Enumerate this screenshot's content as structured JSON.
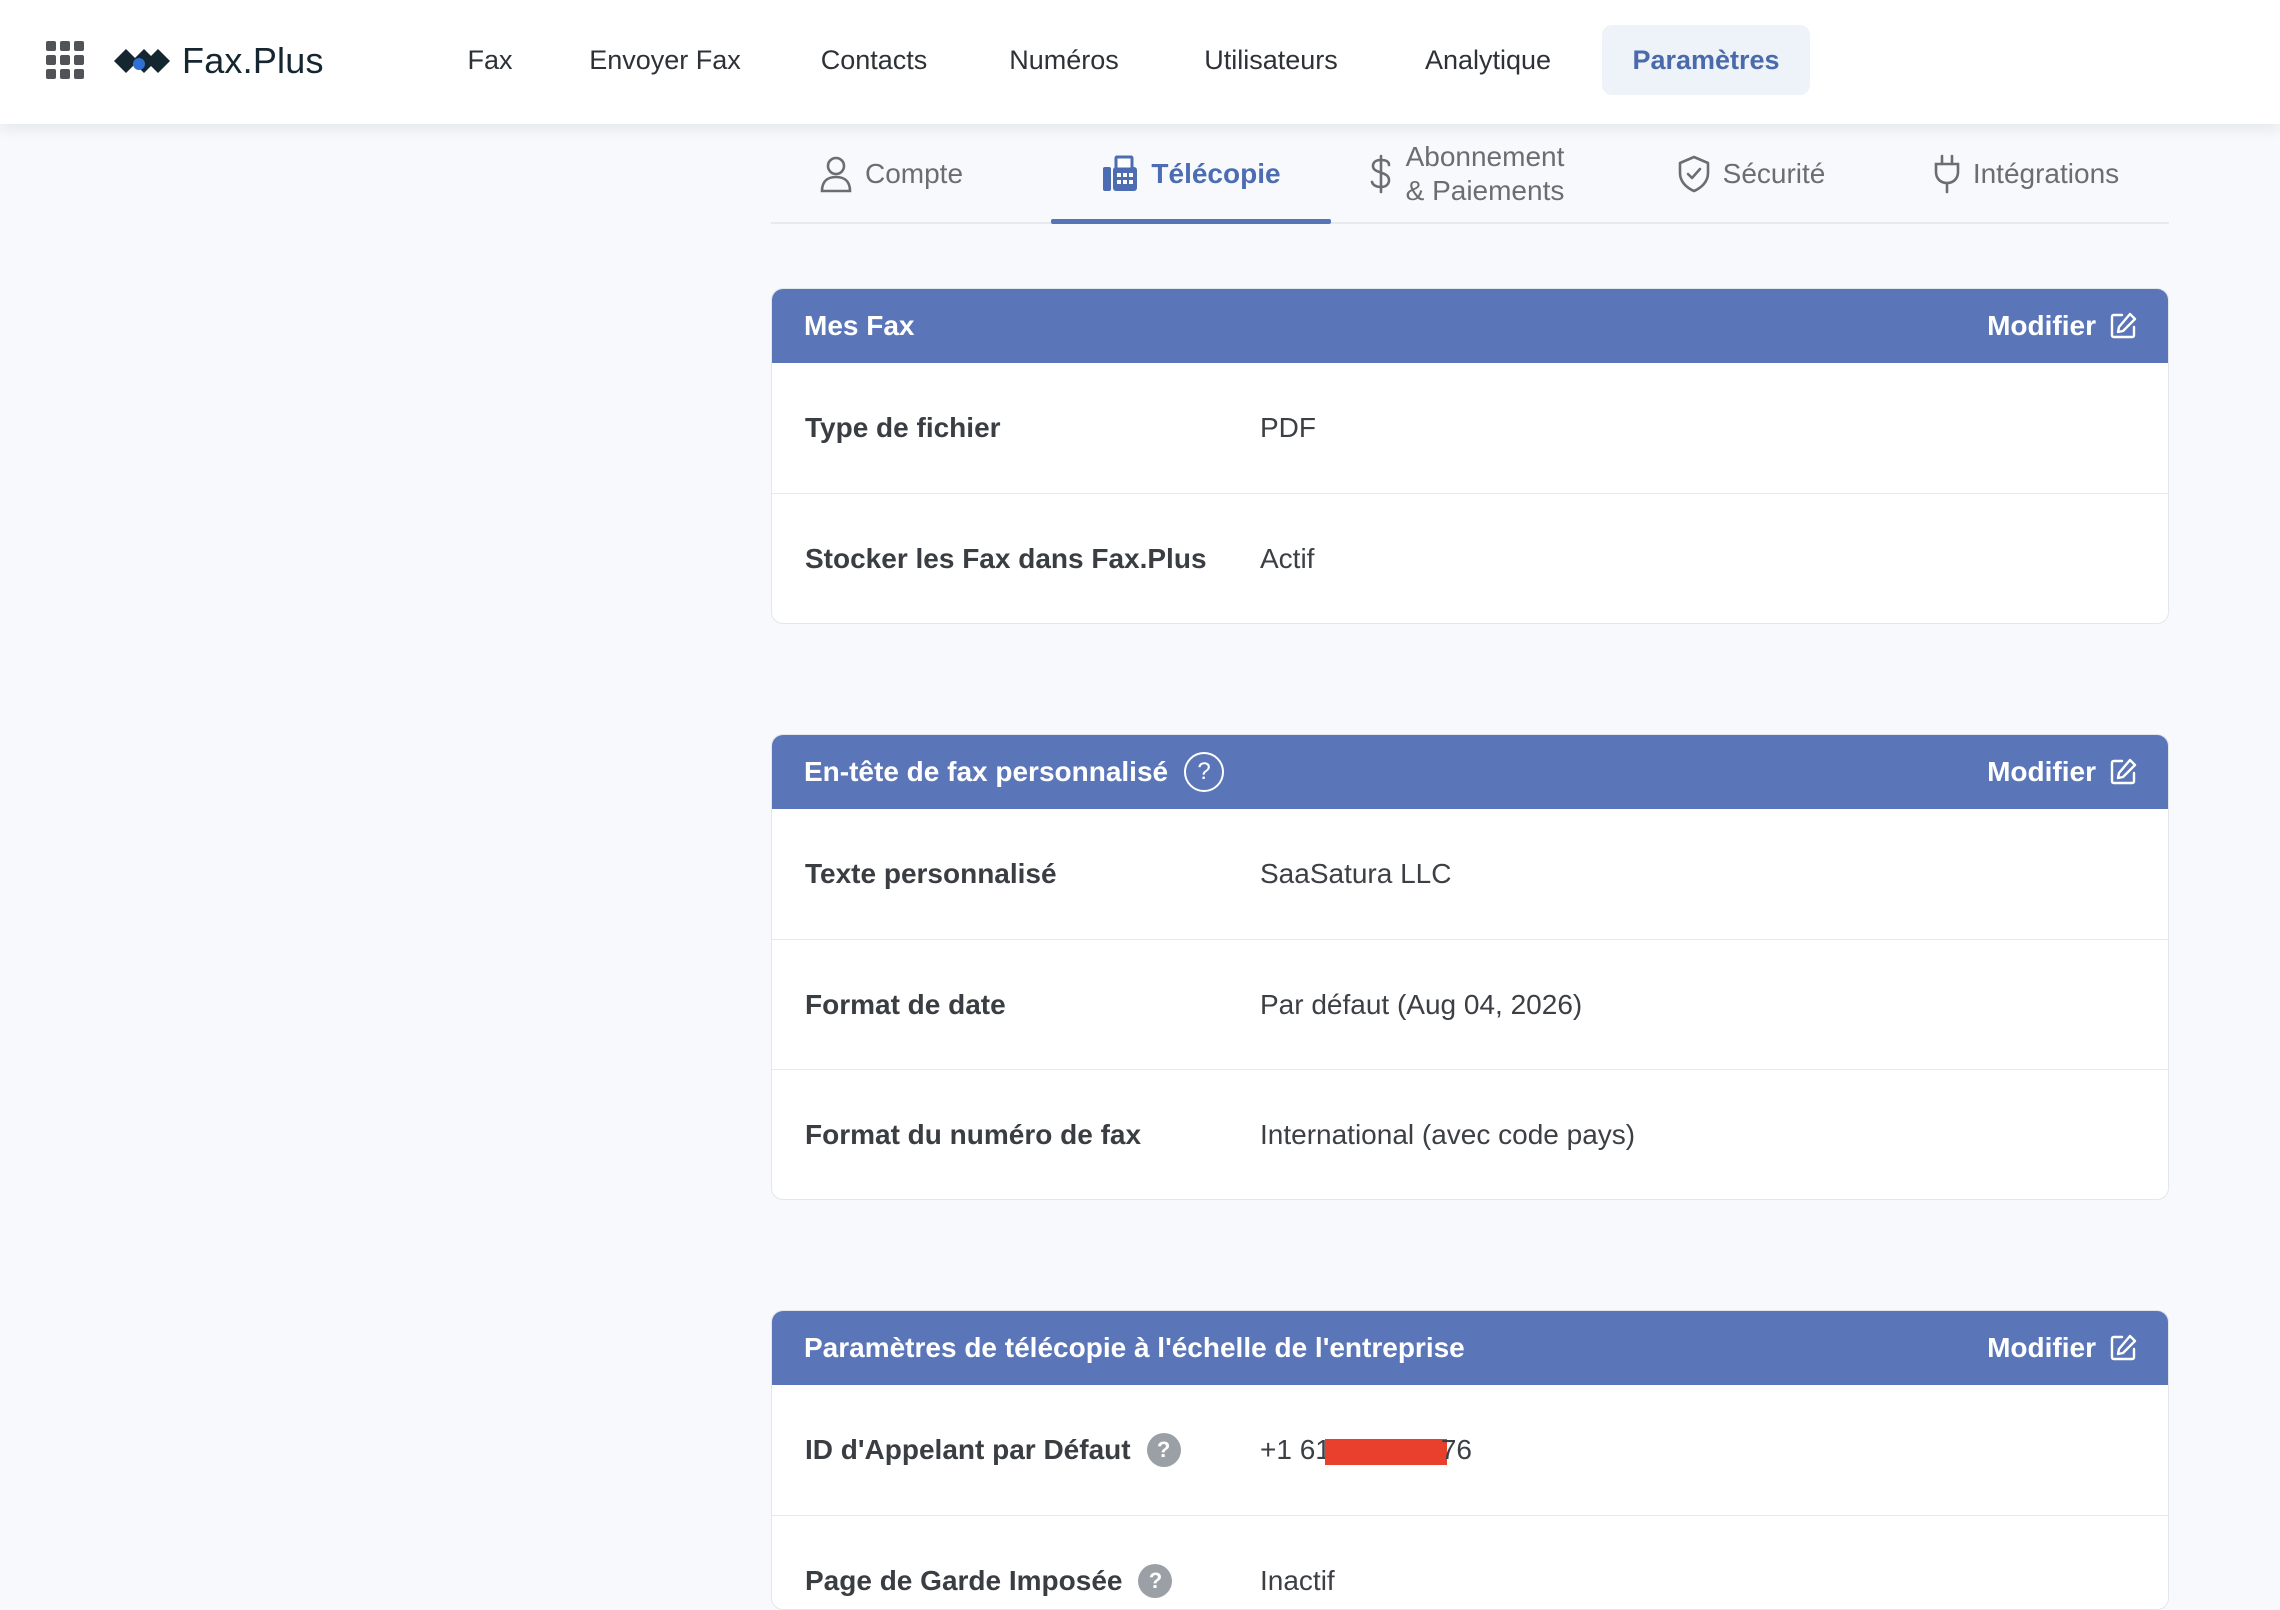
{
  "app": {
    "logo_text": "Fax.Plus"
  },
  "nav": {
    "items": [
      {
        "label": "Fax"
      },
      {
        "label": "Envoyer Fax"
      },
      {
        "label": "Contacts"
      },
      {
        "label": "Numéros"
      },
      {
        "label": "Utilisateurs"
      },
      {
        "label": "Analytique"
      },
      {
        "label": "Paramètres",
        "active": true
      }
    ]
  },
  "tabs": {
    "compte": "Compte",
    "telecopie": "Télécopie",
    "abonnement_line1": "Abonnement",
    "abonnement_line2": "& Paiements",
    "securite": "Sécurité",
    "integrations": "Intégrations",
    "active": "Télécopie"
  },
  "cards": [
    {
      "title": "Mes Fax",
      "modify_label": "Modifier",
      "rows": [
        {
          "label": "Type de fichier",
          "value": "PDF"
        },
        {
          "label": "Stocker les Fax dans Fax.Plus",
          "value": "Actif"
        }
      ]
    },
    {
      "title": "En-tête de fax personnalisé",
      "help": "?",
      "modify_label": "Modifier",
      "rows": [
        {
          "label": "Texte personnalisé",
          "value": "SaaSatura LLC"
        },
        {
          "label": "Format de date",
          "value": "Par défaut (Aug 04, 2026)"
        },
        {
          "label": "Format du numéro de fax",
          "value": "International (avec code pays)"
        }
      ]
    },
    {
      "title": "Paramètres de télécopie à l'échelle de l'entreprise",
      "modify_label": "Modifier",
      "rows": [
        {
          "label": "ID d'Appelant par Défaut",
          "help": "?",
          "value_prefix": "+1 61",
          "value_suffix": "76"
        },
        {
          "label": "Page de Garde Imposée",
          "help": "?",
          "value": "Inactif"
        }
      ]
    }
  ],
  "colors": {
    "header_blue": "#5a76b9",
    "accent": "#4d6db3",
    "redaction": "#e8402c",
    "background": "#f7f9fc"
  },
  "icons": [
    "apps-grid-icon",
    "faxplus-logo-icon",
    "user-icon",
    "fax-machine-icon",
    "dollar-icon",
    "shield-check-icon",
    "plug-icon",
    "edit-icon",
    "help-circle-icon",
    "question-icon"
  ]
}
